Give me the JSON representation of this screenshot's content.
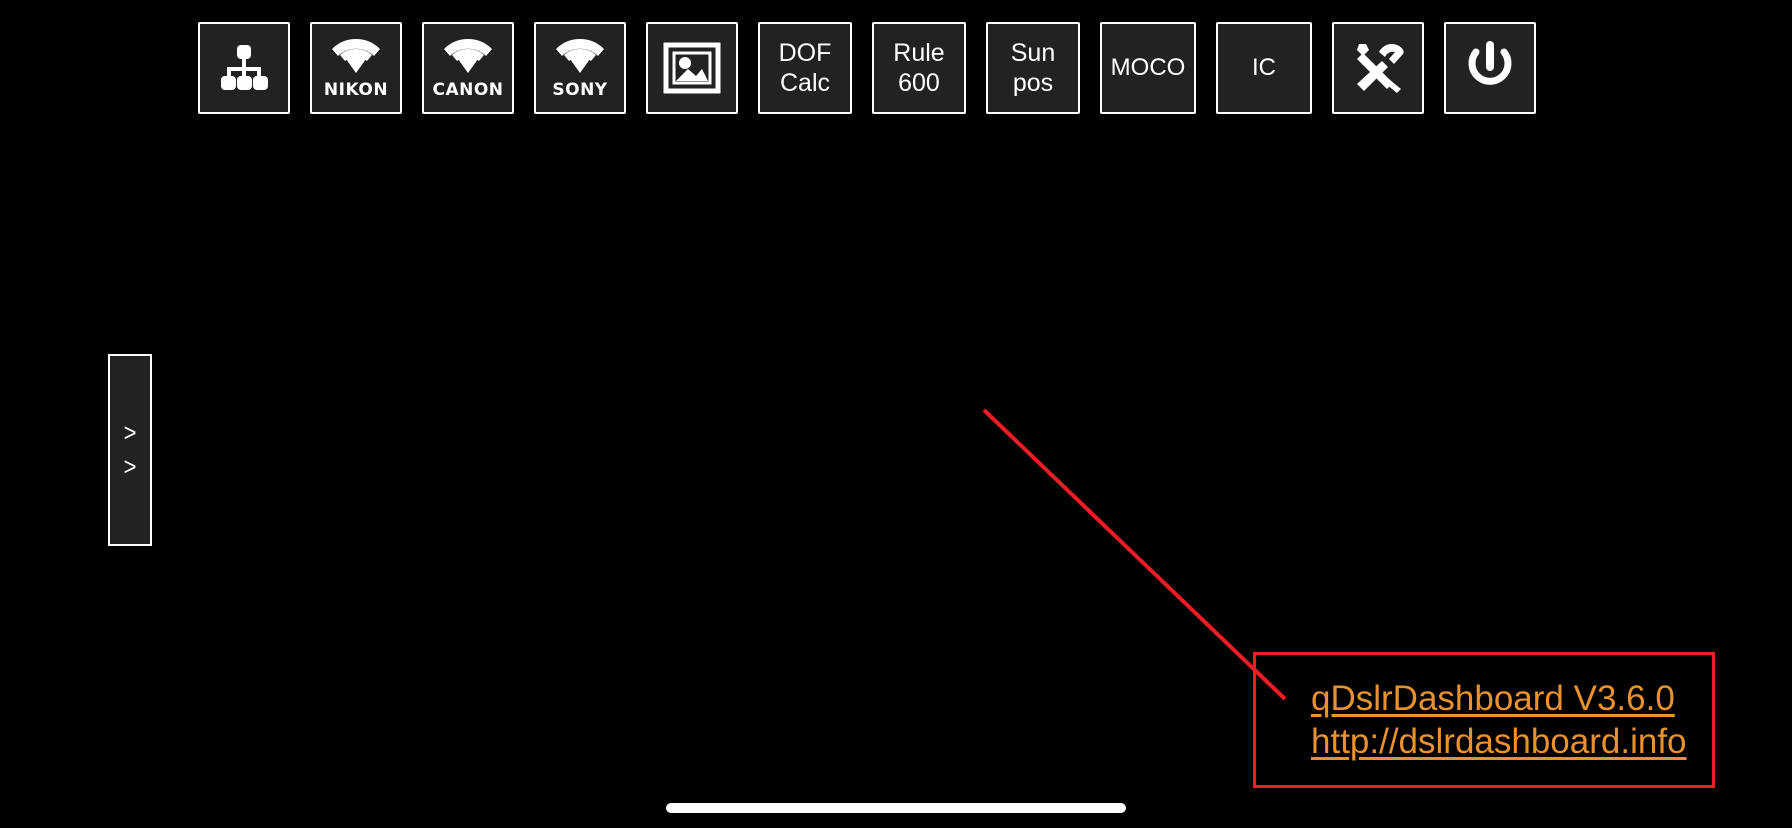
{
  "app": {
    "name": "qDslrDashboard",
    "background_color": "#000000",
    "button_fill_color": "#222222",
    "button_border_color": "#ffffff",
    "accent_orange": "#e8912d",
    "annotation_red": "#ee1c25"
  },
  "toolbar": {
    "buttons": [
      {
        "id": "network",
        "icon": "network-hierarchy-icon",
        "label": "",
        "type": "icon"
      },
      {
        "id": "nikon",
        "icon": "wifi-icon",
        "label": "NIKON",
        "type": "brand"
      },
      {
        "id": "canon",
        "icon": "wifi-icon",
        "label": "CANON",
        "type": "brand"
      },
      {
        "id": "sony",
        "icon": "wifi-icon",
        "label": "SONY",
        "type": "brand"
      },
      {
        "id": "gallery",
        "icon": "image-picture-icon",
        "label": "",
        "type": "icon"
      },
      {
        "id": "dofcalc",
        "icon": "",
        "label": "DOF\nCalc",
        "type": "text"
      },
      {
        "id": "rule600",
        "icon": "",
        "label": "Rule\n600",
        "type": "text"
      },
      {
        "id": "sunpos",
        "icon": "",
        "label": "Sun\npos",
        "type": "text"
      },
      {
        "id": "moco",
        "icon": "",
        "label": "MOCO",
        "type": "text"
      },
      {
        "id": "ic",
        "icon": "",
        "label": "IC",
        "type": "text"
      },
      {
        "id": "tools",
        "icon": "hammer-screwdriver-icon",
        "label": "",
        "type": "icon"
      },
      {
        "id": "power",
        "icon": "power-icon",
        "label": "",
        "type": "icon"
      }
    ]
  },
  "left_panel": {
    "expand_tab": {
      "chevron_top": ">",
      "chevron_bottom": ">"
    }
  },
  "annotation": {
    "version_link": "qDslrDashboard V3.6.0",
    "website_link": "http://dslrdashboard.info"
  }
}
